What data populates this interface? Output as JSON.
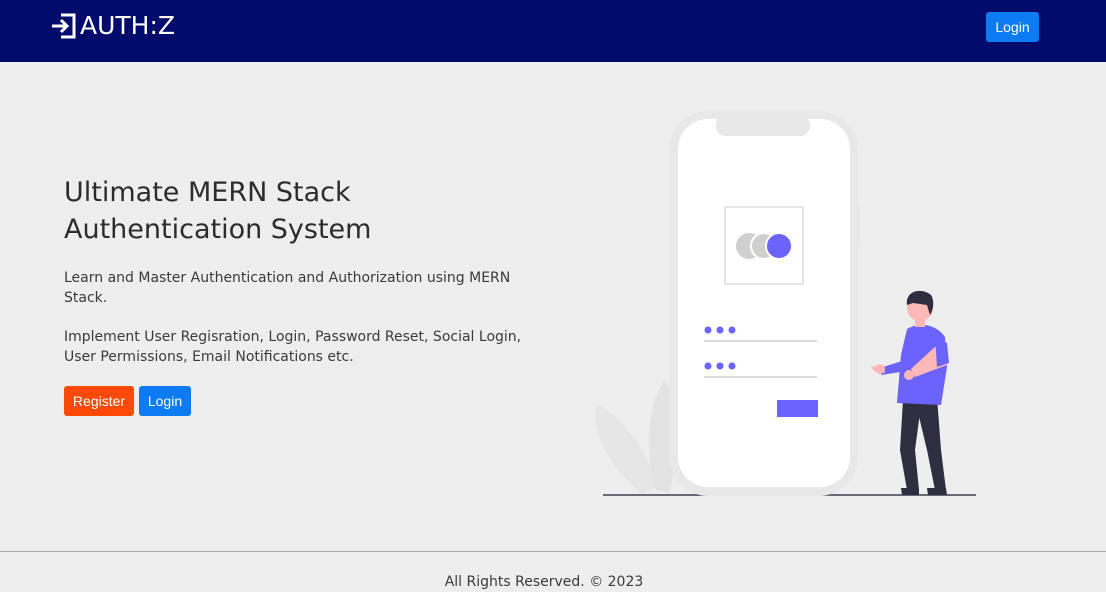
{
  "navbar": {
    "brand_text": "AUTH:Z",
    "login_label": "Login"
  },
  "hero": {
    "title": "Ultimate MERN Stack Authentication System",
    "paragraph1": "Learn and Master Authentication and Authorization using MERN Stack.",
    "paragraph2": "Implement User Regisration, Login, Password Reset, Social Login, User Permissions, Email Notifications etc.",
    "register_label": "Register",
    "login_label": "Login"
  },
  "illustration": {
    "name": "mobile-login-illustration",
    "accent_color": "#6c63ff"
  },
  "footer": {
    "text": "All Rights Reserved. © 2023"
  },
  "colors": {
    "navbar_bg": "#010b6b",
    "page_bg": "#eeeeee",
    "primary_blue": "#0d7bf3",
    "register_orange": "#ff4a07"
  }
}
